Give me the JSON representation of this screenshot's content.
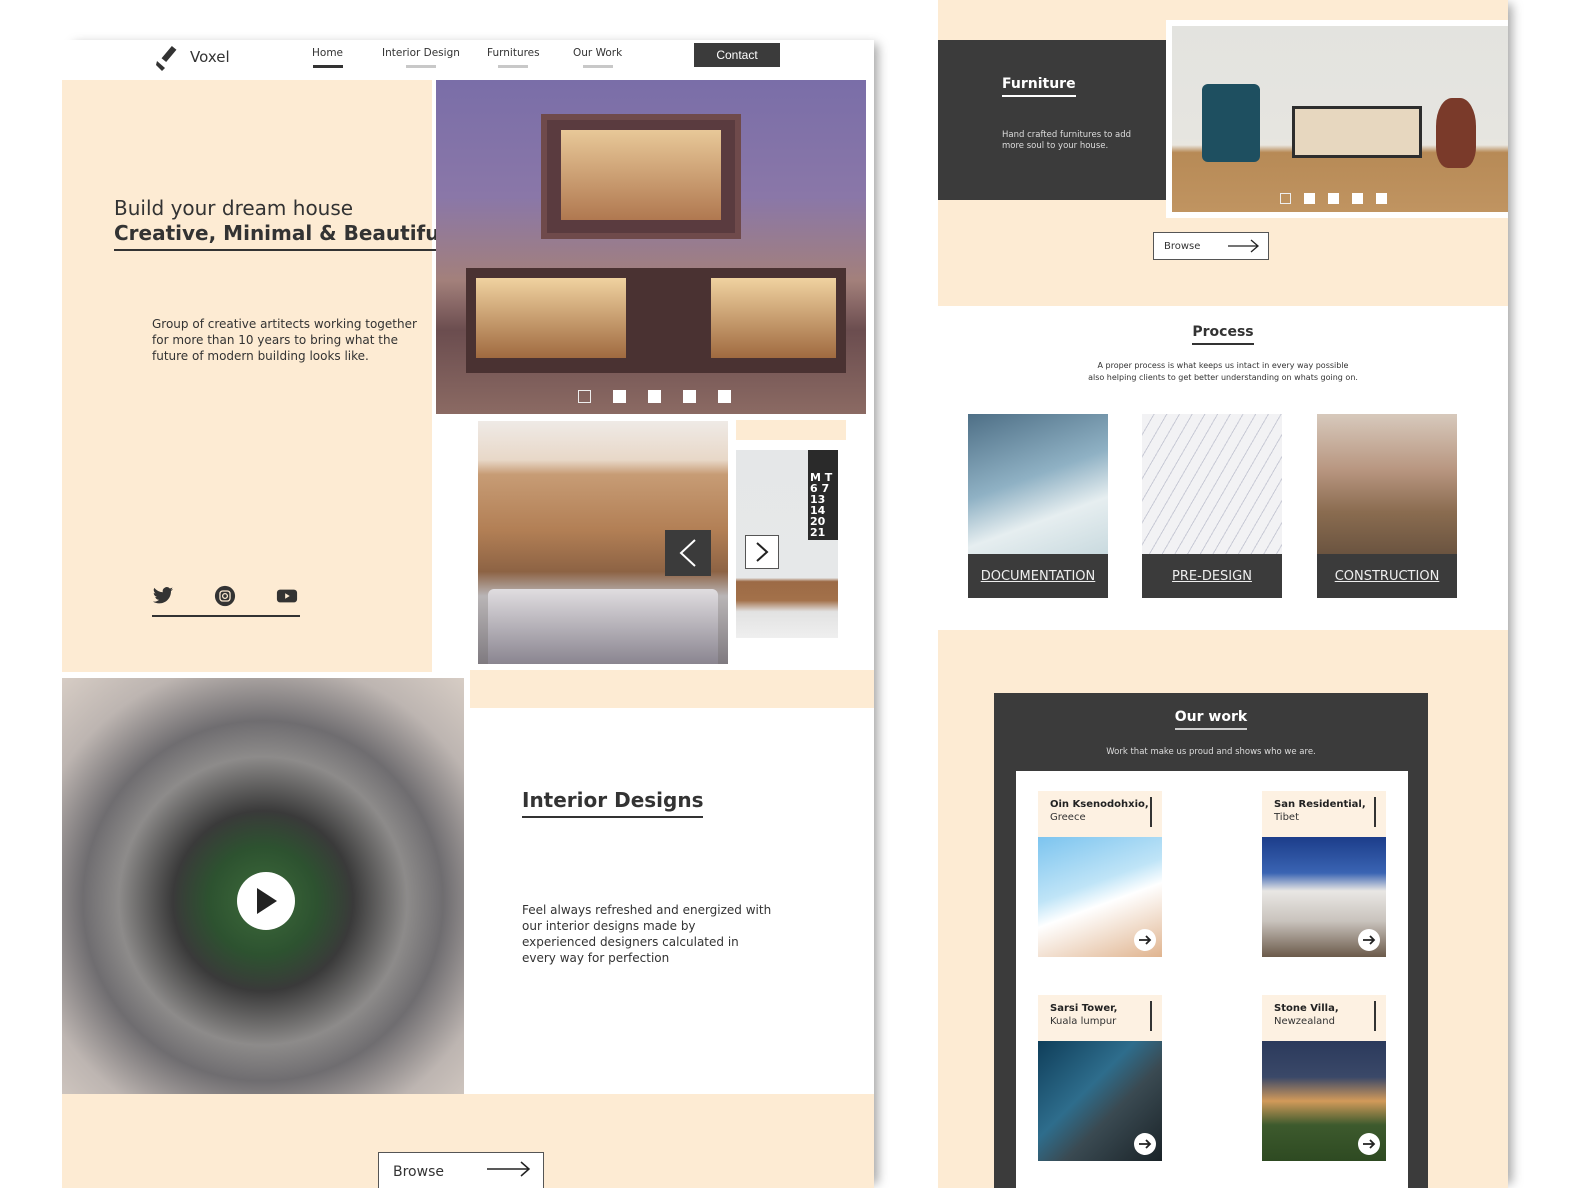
{
  "header": {
    "brand": "Voxel",
    "nav": [
      {
        "label": "Home",
        "active": true
      },
      {
        "label": "Interior Design",
        "active": false
      },
      {
        "label": "Furnitures",
        "active": false
      },
      {
        "label": "Our Work",
        "active": false
      }
    ],
    "contact_label": "Contact"
  },
  "hero": {
    "title_line1": "Build your dream house",
    "title_line2": "Creative, Minimal & Beautiful",
    "description": "Group of creative artitects working together for more than 10 years to bring what the future of modern building looks like.",
    "social": [
      "twitter-icon",
      "instagram-icon",
      "youtube-icon"
    ],
    "carousel_slides": 5,
    "carousel_active": 1
  },
  "interior": {
    "title": "Interior Designs",
    "description": "Feel always refreshed and energized with our interior designs made by experienced designers calculated in every way for perfection",
    "carousel_slides": 5,
    "carousel_active": 1,
    "browse_label": "Browse"
  },
  "furniture": {
    "title": "Furniture",
    "description": "Hand crafted furnitures to add more soul to your house.",
    "carousel_slides": 5,
    "carousel_active": 1,
    "browse_label": "Browse"
  },
  "process": {
    "title": "Process",
    "description_line1": "A proper process is what keeps us intact in every way possible",
    "description_line2": "also helping clients to get better understanding on whats going on.",
    "steps": [
      {
        "label": "DOCUMENTATION"
      },
      {
        "label": "PRE-DESIGN"
      },
      {
        "label": "CONSTRUCTION"
      }
    ]
  },
  "work": {
    "title": "Our work",
    "description": "Work that make us proud and shows who we are.",
    "projects": [
      {
        "name": "Oin Ksenodohxio,",
        "location": "Greece"
      },
      {
        "name": "San Residential,",
        "location": "Tibet"
      },
      {
        "name": "Sarsi Tower,",
        "location": "Kuala lumpur"
      },
      {
        "name": "Stone Villa,",
        "location": "Newzealand"
      }
    ]
  },
  "colors": {
    "peach": "#fdebd3",
    "dark": "#3b3b3b",
    "white": "#ffffff"
  }
}
